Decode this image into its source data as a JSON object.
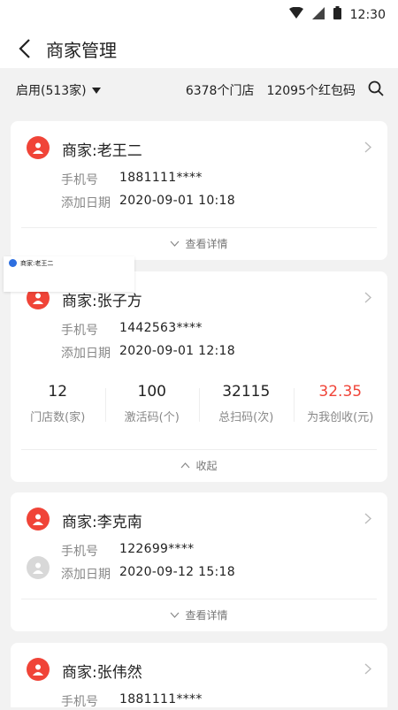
{
  "statusbar": {
    "time": "12:30"
  },
  "appbar": {
    "title": "商家管理"
  },
  "filter": {
    "status_label": "启用(513家)",
    "stores": "6378个门店",
    "redpacks": "12095个红包码"
  },
  "labels": {
    "phone": "手机号",
    "date": "添加日期",
    "expand": "查看详情",
    "collapse": "收起"
  },
  "merchants": [
    {
      "name": "商家:老王二",
      "phone": "1881111****",
      "date": "2020-09-01 10:18"
    },
    {
      "name": "商家:张子方",
      "phone": "1442563****",
      "date": "2020-09-01 12:18",
      "stats": [
        {
          "value": "12",
          "label": "门店数(家)"
        },
        {
          "value": "100",
          "label": "激活码(个)"
        },
        {
          "value": "32115",
          "label": "总扫码(次)"
        },
        {
          "value": "32.35",
          "label": "为我创收(元)"
        }
      ]
    },
    {
      "name": "商家:李克南",
      "phone": "122699****",
      "date": "2020-09-12 15:18"
    },
    {
      "name": "商家:张伟然",
      "phone": "1881111****"
    }
  ],
  "toast": {
    "text": "商家:老王二"
  },
  "colors": {
    "accent": "#f04438",
    "background": "#f2f2f2"
  }
}
